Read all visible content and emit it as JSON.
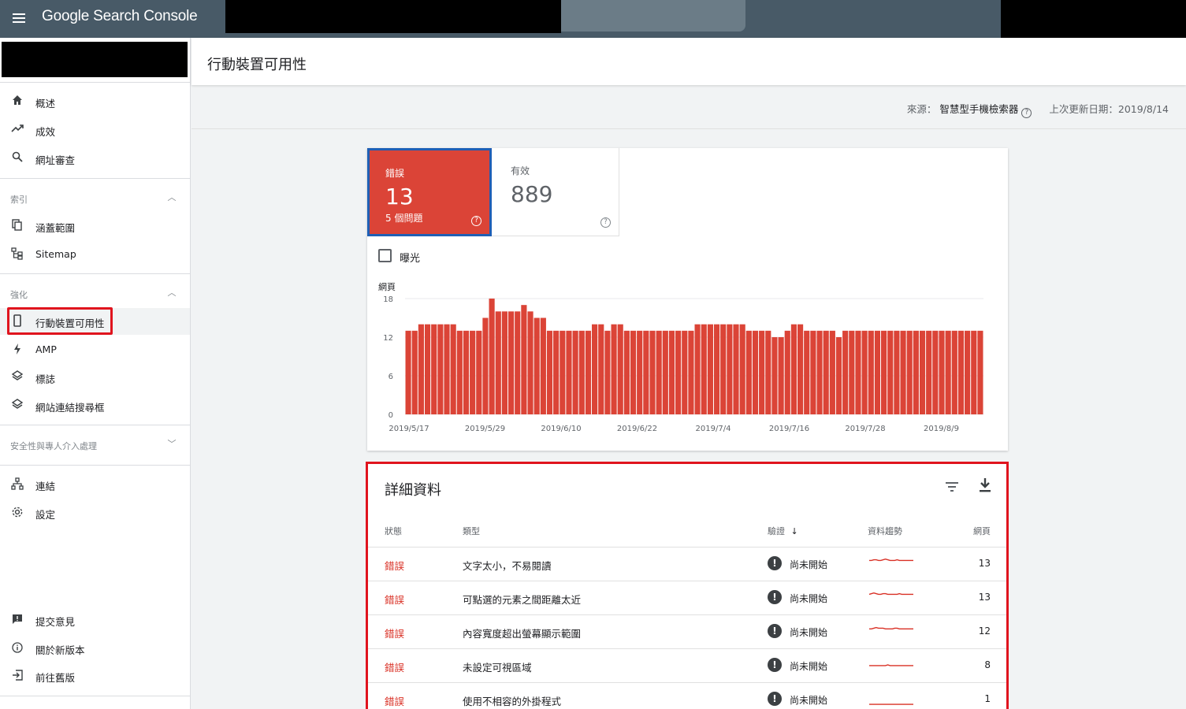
{
  "app": {
    "title": "Google Search Console"
  },
  "sidebar": {
    "top_items": [
      {
        "label": "概述",
        "icon": "home-icon"
      },
      {
        "label": "成效",
        "icon": "trending-up-icon"
      },
      {
        "label": "網址審查",
        "icon": "search-icon"
      }
    ],
    "sections": [
      {
        "label": "索引",
        "items": [
          {
            "label": "涵蓋範圍",
            "icon": "copy-icon"
          },
          {
            "label": "Sitemap",
            "icon": "sitemap-icon"
          }
        ]
      },
      {
        "label": "強化",
        "items": [
          {
            "label": "行動裝置可用性",
            "icon": "phone-icon"
          },
          {
            "label": "AMP",
            "icon": "bolt-icon"
          },
          {
            "label": "標誌",
            "icon": "layers-icon"
          },
          {
            "label": "網站連結搜尋框",
            "icon": "layers-icon"
          }
        ]
      },
      {
        "label": "安全性與專人介入處理"
      }
    ],
    "bottom_items": [
      {
        "label": "連結",
        "icon": "links-icon"
      },
      {
        "label": "設定",
        "icon": "settings-icon"
      }
    ],
    "footer_items": [
      {
        "label": "提交意見",
        "icon": "feedback-icon"
      },
      {
        "label": "關於新版本",
        "icon": "info-icon"
      },
      {
        "label": "前往舊版",
        "icon": "exit-icon"
      }
    ]
  },
  "header": {
    "title": "行動裝置可用性"
  },
  "meta": {
    "source_label": "來源：",
    "source_value": "智慧型手機檢索器",
    "updated_label": "上次更新日期：",
    "updated_value": "2019/8/14"
  },
  "summary": {
    "error_label": "錯誤",
    "error_count": "13",
    "error_sub": "5 個問題",
    "valid_label": "有效",
    "valid_count": "889",
    "impressions_label": "曝光"
  },
  "chart_data": {
    "type": "bar",
    "ylabel": "網頁",
    "yticks": [
      0,
      6,
      12,
      18
    ],
    "ylim": [
      0,
      18
    ],
    "xticks": [
      "2019/5/17",
      "2019/5/29",
      "2019/6/10",
      "2019/6/22",
      "2019/7/4",
      "2019/7/16",
      "2019/7/28",
      "2019/8/9"
    ],
    "color": "#db4437",
    "values": [
      13,
      13,
      14,
      14,
      14,
      14,
      14,
      14,
      13,
      13,
      13,
      13,
      15,
      18,
      16,
      16,
      16,
      16,
      17,
      16,
      15,
      15,
      13,
      13,
      13,
      13,
      13,
      13,
      13,
      14,
      14,
      13,
      14,
      14,
      13,
      13,
      13,
      13,
      13,
      13,
      13,
      13,
      13,
      13,
      13,
      14,
      14,
      14,
      14,
      14,
      14,
      14,
      14,
      13,
      13,
      13,
      13,
      12,
      12,
      13,
      14,
      14,
      13,
      13,
      13,
      13,
      13,
      12,
      13,
      13,
      13,
      13,
      13,
      13,
      13,
      13,
      13,
      13,
      13,
      13,
      13,
      13,
      13,
      13,
      13,
      13,
      13,
      13,
      13,
      13
    ]
  },
  "details": {
    "title": "詳細資料",
    "columns": {
      "status": "狀態",
      "type": "類型",
      "validation": "驗證",
      "trend": "資料趨勢",
      "pages": "網頁"
    },
    "rows": [
      {
        "status": "錯誤",
        "type": "文字太小，不易閱讀",
        "validation": "尚未開始",
        "pages": "13",
        "trend": [
          13,
          13,
          14,
          14,
          13,
          13,
          14,
          15,
          14,
          13,
          13,
          13,
          14,
          13,
          13,
          13,
          13,
          13,
          13,
          13
        ]
      },
      {
        "status": "錯誤",
        "type": "可點選的元素之間距離太近",
        "validation": "尚未開始",
        "pages": "13",
        "trend": [
          13,
          14,
          15,
          14,
          13,
          13,
          14,
          14,
          13,
          13,
          13,
          13,
          13,
          14,
          13,
          13,
          13,
          13,
          13,
          13
        ]
      },
      {
        "status": "錯誤",
        "type": "內容寬度超出螢幕顯示範圍",
        "validation": "尚未開始",
        "pages": "12",
        "trend": [
          12,
          12,
          13,
          14,
          13,
          13,
          13,
          12,
          12,
          12,
          12,
          13,
          13,
          12,
          12,
          12,
          12,
          12,
          12,
          12
        ]
      },
      {
        "status": "錯誤",
        "type": "未設定可視區域",
        "validation": "尚未開始",
        "pages": "8",
        "trend": [
          8,
          8,
          8,
          8,
          8,
          8,
          8,
          8,
          9,
          8,
          8,
          8,
          8,
          8,
          8,
          8,
          8,
          8,
          8,
          8
        ]
      },
      {
        "status": "錯誤",
        "type": "使用不相容的外掛程式",
        "validation": "尚未開始",
        "pages": "1",
        "trend": [
          1,
          1,
          1,
          1,
          1,
          1,
          1,
          1,
          1,
          1,
          1,
          1,
          1,
          1,
          1,
          1,
          1,
          1,
          1,
          1
        ]
      }
    ]
  }
}
